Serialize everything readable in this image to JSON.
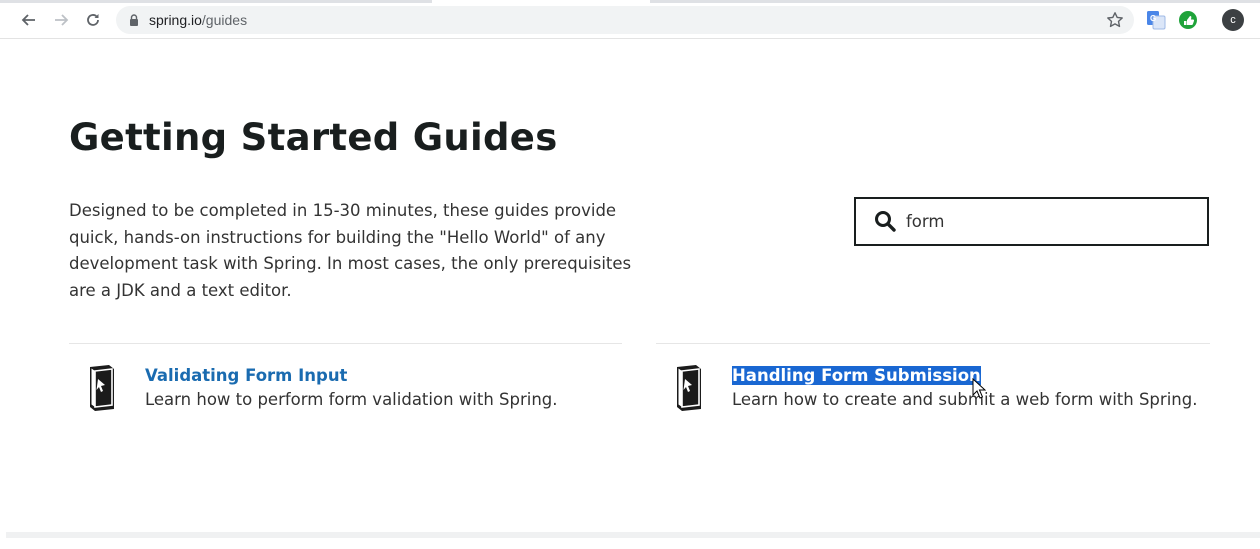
{
  "browser": {
    "url_host": "spring.io",
    "url_path": "/guides",
    "profile_initial": "c"
  },
  "page": {
    "title": "Getting Started Guides",
    "intro": "Designed to be completed in 15-30 minutes, these guides provide quick, hands-on instructions for building the \"Hello World\" of any development task with Spring. In most cases, the only prerequisites are a JDK and a text editor."
  },
  "search": {
    "value": "form"
  },
  "guides": [
    {
      "title": "Validating Form Input",
      "description": "Learn how to perform form validation with Spring."
    },
    {
      "title": "Handling Form Submission",
      "description": "Learn how to create and submit a web form with Spring."
    }
  ],
  "colors": {
    "link": "#1a6bb0",
    "selection": "#1967d2",
    "heading": "#191e1e"
  }
}
